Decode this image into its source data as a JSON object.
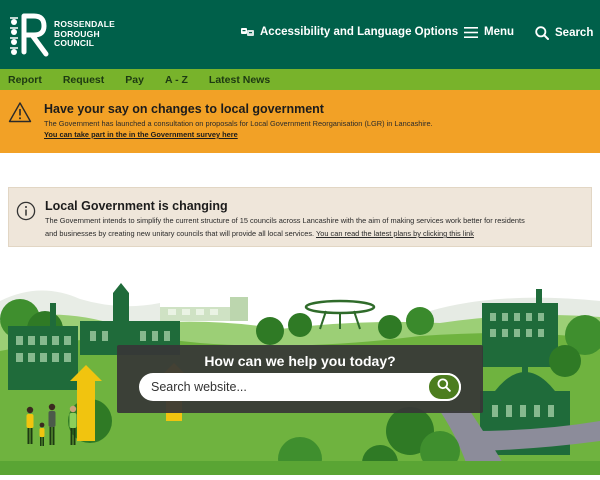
{
  "header": {
    "logo_lines": [
      "ROSSENDALE",
      "BOROUGH",
      "COUNCIL"
    ],
    "accessibility_label": "Accessibility and Language Options",
    "menu_label": "Menu",
    "search_label": "Search"
  },
  "subnav": {
    "items": [
      {
        "label": "Report"
      },
      {
        "label": "Request"
      },
      {
        "label": "Pay"
      },
      {
        "label": "A - Z"
      },
      {
        "label": "Latest News"
      }
    ]
  },
  "alert_lgr": {
    "title": "Have your say on changes to local government",
    "body": "The Government has launched a consultation on proposals for Local Government Reorganisation (LGR) in Lancashire.",
    "link": "You can take part in the in the Government survey here"
  },
  "alert_changing": {
    "title": "Local Government is changing",
    "body_line1": "The Government intends to simplify the current structure of 15 councils across Lancashire with the aim of making services work better for residents",
    "body_line2": "and businesses by creating new unitary councils that will provide all local services.",
    "link": "You can read the latest plans by clicking this link"
  },
  "hero": {
    "heading": "How can we help you today?",
    "search_placeholder": "Search website..."
  },
  "colors": {
    "header_green": "#00604a",
    "subnav_green": "#78b32b",
    "alert_orange": "#f2a126",
    "alert_beige": "#efe6da",
    "search_button": "#4c7d1e"
  },
  "icons": [
    "rossendale-logo",
    "translate-icon",
    "menu-icon",
    "search-icon",
    "warning-icon",
    "info-icon",
    "search-submit-icon"
  ]
}
